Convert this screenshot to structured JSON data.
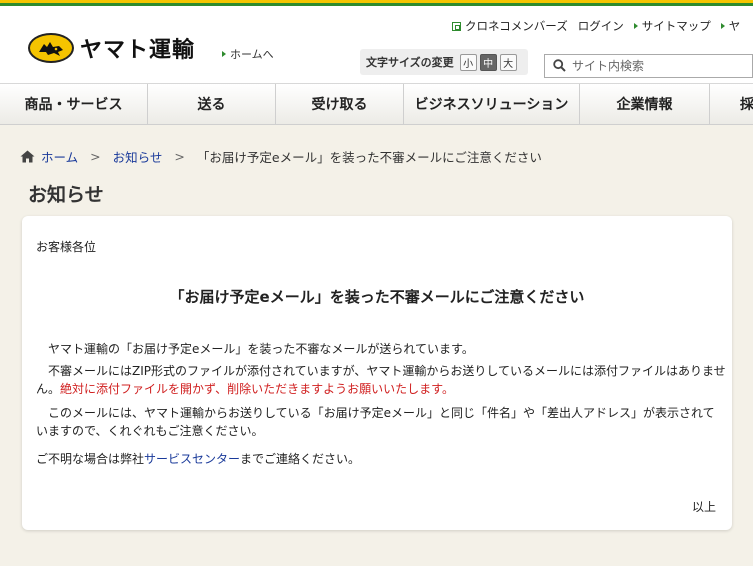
{
  "header": {
    "logo_text": "ヤマト運輸",
    "home_link": "ホームへ",
    "utility_links": [
      "クロネコメンバーズ",
      "ログイン",
      "サイトマップ",
      "ヤ"
    ],
    "font_size": {
      "label": "文字サイズの変更",
      "options": [
        "小",
        "中",
        "大"
      ],
      "selected": "中"
    },
    "search": {
      "placeholder": "サイト内検索"
    }
  },
  "nav": {
    "items": [
      "商品・サービス",
      "送る",
      "受け取る",
      "ビジネスソリューション",
      "企業情報",
      "採"
    ]
  },
  "breadcrumb": {
    "home": "ホーム",
    "parent": "お知らせ",
    "current": "「お届け予定eメール」を装った不審メールにご注意ください"
  },
  "page": {
    "title": "お知らせ",
    "salutation": "お客様各位",
    "notice_title": "「お届け予定eメール」を装った不審メールにご注意ください",
    "para1": "ヤマト運輸の「お届け予定eメール」を装った不審なメールが送られています。",
    "para2": "不審メールにはZIP形式のファイルが添付されていますが、ヤマト運輸からお送りしているメールには添付ファイルはありません。",
    "para2_warning": "絶対に添付ファイルを開かず、削除いただきますようお願いいたします。",
    "para3": "このメールには、ヤマト運輸からお送りしている「お届け予定eメール」と同じ「件名」や「差出人アドレス」が表示されていますので、くれぐれもご注意ください。",
    "para4_before": "ご不明な場合は弊社",
    "para4_link": "サービスセンター",
    "para4_after": "までご連絡ください。",
    "closing": "以上"
  },
  "colors": {
    "brand_yellow": "#f5c400",
    "brand_green": "#2e8b2e",
    "link_blue": "#1a3a9a",
    "warning_red": "#d02020"
  }
}
